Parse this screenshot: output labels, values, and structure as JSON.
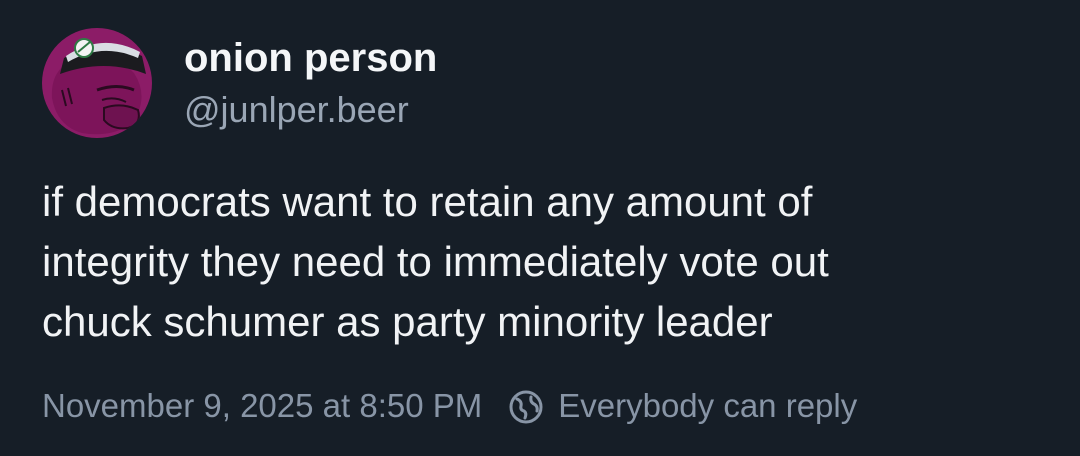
{
  "author": {
    "display_name": "onion person",
    "handle": "@junlper.beer"
  },
  "post": {
    "text": "if democrats want to retain any amount of\nintegrity they need to immediately vote out\nchuck schumer as party minority leader",
    "timestamp": "November 9, 2025 at 8:50 PM",
    "reply_setting": "Everybody can reply"
  },
  "icons": {
    "reply_setting_icon": "globe-earth-icon"
  },
  "colors": {
    "background": "#161e27",
    "text_primary": "#f1f3f5",
    "text_secondary": "#8895a6",
    "avatar_bg": "#8c1c67"
  }
}
